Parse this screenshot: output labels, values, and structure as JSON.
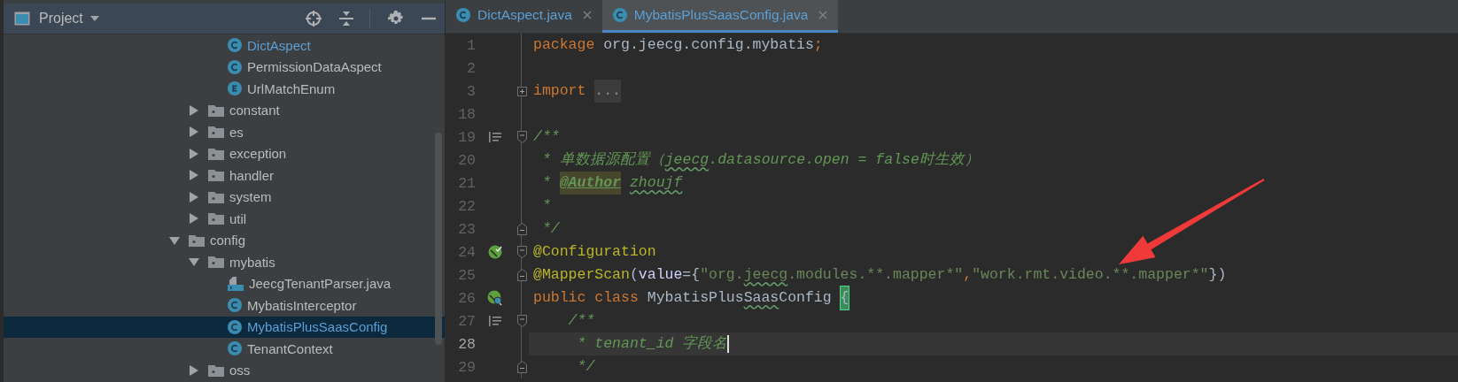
{
  "project_panel": {
    "title": "Project",
    "tree": [
      {
        "children": [
          {
            "children": [
              {
                "label": "DictAspect",
                "kind": "class",
                "selected": false,
                "modified": true
              },
              {
                "label": "PermissionDataAspect",
                "kind": "class",
                "selected": false,
                "modified": false
              },
              {
                "label": "UrlMatchEnum",
                "kind": "enum",
                "selected": false,
                "modified": false
              }
            ]
          },
          {
            "label": "constant",
            "kind": "folder",
            "expanded": false,
            "selected": false,
            "modified": false
          },
          {
            "label": "es",
            "kind": "folder",
            "expanded": false,
            "selected": false,
            "modified": false
          },
          {
            "label": "exception",
            "kind": "folder",
            "expanded": false,
            "selected": false,
            "modified": false
          },
          {
            "label": "handler",
            "kind": "folder",
            "expanded": false,
            "selected": false,
            "modified": false
          },
          {
            "label": "system",
            "kind": "folder",
            "expanded": false,
            "selected": false,
            "modified": false
          },
          {
            "label": "util",
            "kind": "folder",
            "expanded": false,
            "selected": false,
            "modified": false
          }
        ]
      },
      {
        "label": "config",
        "kind": "folder",
        "expanded": true,
        "selected": false,
        "modified": false,
        "children": [
          {
            "label": "mybatis",
            "kind": "folder",
            "expanded": true,
            "selected": false,
            "modified": false,
            "children": [
              {
                "label": "JeecgTenantParser.java",
                "kind": "java",
                "selected": false,
                "modified": false
              },
              {
                "label": "MybatisInterceptor",
                "kind": "class",
                "selected": false,
                "modified": false
              },
              {
                "label": "MybatisPlusSaasConfig",
                "kind": "class",
                "selected": true,
                "modified": true
              },
              {
                "label": "TenantContext",
                "kind": "class",
                "selected": false,
                "modified": false
              }
            ]
          },
          {
            "label": "oss",
            "kind": "folder",
            "expanded": false,
            "selected": false,
            "modified": false
          }
        ]
      }
    ]
  },
  "editor": {
    "tabs": [
      {
        "label": "DictAspect.java",
        "kind": "class",
        "selected": false
      },
      {
        "label": "MybatisPlusSaasConfig.java",
        "kind": "class",
        "selected": true
      }
    ],
    "lines": [
      {
        "number": "1",
        "current": false,
        "tokens": [
          {
            "text": "package ",
            "kind": "keyword",
            "typo": false
          },
          {
            "text": "org.jeecg.config.mybatis",
            "kind": "plain",
            "typo": false
          },
          {
            "text": ";",
            "kind": "keyword",
            "typo": false
          }
        ]
      },
      {
        "number": "2",
        "current": false
      },
      {
        "number": "3",
        "current": false,
        "fold": {
          "kind": "collapsed"
        },
        "tokens": [
          {
            "text": "import ",
            "kind": "keyword",
            "typo": false
          },
          {
            "text": "...",
            "kind": "folded",
            "typo": false
          }
        ]
      },
      {
        "number": "18",
        "current": false
      },
      {
        "number": "19",
        "current": false,
        "fold": {
          "kind": "start"
        },
        "gutter": {
          "kind": "doc"
        },
        "tokens": [
          {
            "text": "/**",
            "kind": "comment",
            "typo": false
          }
        ]
      },
      {
        "number": "20",
        "current": false,
        "tokens": [
          {
            "text": " * 单数据源配置（",
            "kind": "comment",
            "typo": false
          },
          {
            "text": "jeecg",
            "kind": "comment",
            "typo": true
          },
          {
            "text": ".datasource.open = false时生效）",
            "kind": "comment",
            "typo": false
          }
        ]
      },
      {
        "number": "21",
        "current": false,
        "tokens": [
          {
            "text": " * ",
            "kind": "comment",
            "typo": false
          },
          {
            "text": "@Author",
            "kind": "doc-tag",
            "typo": false
          },
          {
            "text": " zhoujf",
            "kind": "comment",
            "typo": true
          }
        ]
      },
      {
        "number": "22",
        "current": false,
        "tokens": [
          {
            "text": " *",
            "kind": "comment",
            "typo": false
          }
        ]
      },
      {
        "number": "23",
        "current": false,
        "fold": {
          "kind": "end"
        },
        "tokens": [
          {
            "text": " */",
            "kind": "comment",
            "typo": false
          }
        ]
      },
      {
        "number": "24",
        "current": false,
        "fold": {
          "kind": "start"
        },
        "gutter": {
          "kind": "bean"
        },
        "tokens": [
          {
            "text": "@Configuration",
            "kind": "annotation",
            "typo": false
          }
        ]
      },
      {
        "number": "25",
        "current": false,
        "fold": {
          "kind": "end"
        },
        "tokens": [
          {
            "text": "@MapperScan",
            "kind": "annotation",
            "typo": false
          },
          {
            "text": "(",
            "kind": "plain",
            "typo": false
          },
          {
            "text": "value",
            "kind": "param",
            "typo": false
          },
          {
            "text": "={",
            "kind": "plain",
            "typo": false
          },
          {
            "text": "\"org.",
            "kind": "string",
            "typo": false
          },
          {
            "text": "jeecg",
            "kind": "string",
            "typo": true
          },
          {
            "text": ".modules.**.mapper*\"",
            "kind": "string",
            "typo": false
          },
          {
            "text": ",",
            "kind": "keyword",
            "typo": false
          },
          {
            "text": "\"work.rmt.video.**.mapper*\"",
            "kind": "string",
            "typo": false
          },
          {
            "text": "})",
            "kind": "plain",
            "typo": false
          }
        ]
      },
      {
        "number": "26",
        "current": false,
        "gutter": {
          "kind": "bean-find"
        },
        "tokens": [
          {
            "text": "public class ",
            "kind": "keyword",
            "typo": false
          },
          {
            "text": "MybatisPlus",
            "kind": "plain",
            "typo": false
          },
          {
            "text": "Saas",
            "kind": "plain",
            "typo": true
          },
          {
            "text": "Config ",
            "kind": "plain",
            "typo": false
          },
          {
            "text": "{",
            "kind": "brace-match",
            "typo": false
          }
        ]
      },
      {
        "number": "27",
        "current": false,
        "fold": {
          "kind": "start"
        },
        "gutter": {
          "kind": "doc"
        },
        "tokens": [
          {
            "text": "    /**",
            "kind": "comment",
            "typo": false
          }
        ]
      },
      {
        "number": "28",
        "current": true,
        "tokens": [
          {
            "text": "     * tenant_id 字段名",
            "kind": "comment",
            "typo": false
          }
        ]
      },
      {
        "number": "29",
        "current": false,
        "fold": {
          "kind": "end"
        },
        "tokens": [
          {
            "text": "     */",
            "kind": "comment",
            "typo": false
          }
        ]
      }
    ]
  }
}
